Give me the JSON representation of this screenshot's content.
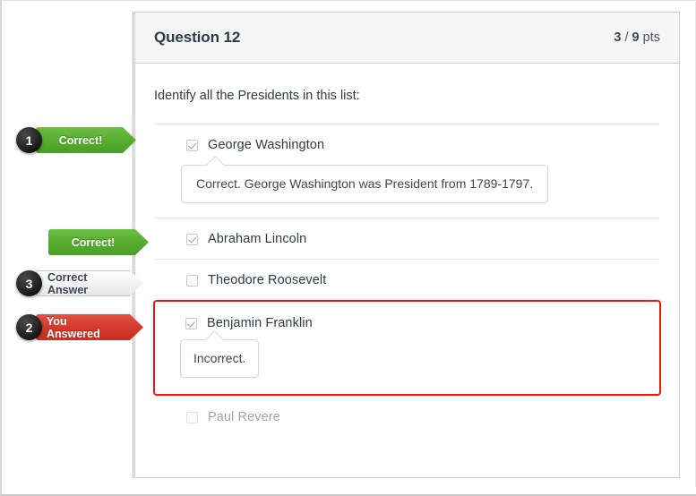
{
  "card": {
    "title": "Question 12",
    "score": "3 / 9 pts",
    "score_earned": "3",
    "score_separator": " / ",
    "score_possible": "9",
    "score_unit": " pts",
    "prompt": "Identify all the Presidents in this list:"
  },
  "answers": [
    {
      "label": "George Washington",
      "checkbox": "checkbox-checked-icon",
      "checked": true,
      "muted": false,
      "feedback": "Correct. George Washington was President from 1789-1797."
    },
    {
      "label": "Abraham Lincoln",
      "checkbox": "checkbox-checked-icon",
      "checked": true,
      "muted": false,
      "feedback": null
    },
    {
      "label": "Theodore Roosevelt",
      "checkbox": "checkbox-unchecked-icon",
      "checked": false,
      "muted": false,
      "feedback": null
    },
    {
      "label": "Benjamin Franklin",
      "checkbox": "checkbox-checked-icon",
      "checked": true,
      "muted": false,
      "feedback": "Incorrect."
    },
    {
      "label": "Paul Revere",
      "checkbox": "checkbox-unchecked-icon",
      "checked": false,
      "muted": true,
      "feedback": null
    }
  ],
  "callouts": [
    {
      "number": "1",
      "label": "Correct!",
      "style": "green"
    },
    {
      "number": "",
      "label": "Correct!",
      "style": "green"
    },
    {
      "number": "3",
      "label": "Correct Answer",
      "style": "gray"
    },
    {
      "number": "2",
      "label": "You Answered",
      "style": "red"
    }
  ],
  "colors": {
    "correct_green": "#57ad2f",
    "incorrect_red": "#d43a2b",
    "highlight_border_red": "#ea1a0f",
    "neutral_gray": "#f2f2f2",
    "badge_black": "#1e1e1e",
    "header_bg": "#f5f5f5",
    "text_primary": "#2d3b45",
    "text_muted": "#9aa4ad"
  }
}
